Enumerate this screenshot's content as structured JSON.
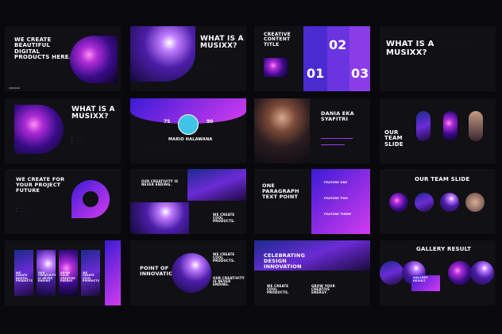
{
  "slides": {
    "s1": {
      "title": "WE CREATE BEAUTIFUL DIGITAL PRODUCTS HERE."
    },
    "s2": {
      "title": "WHAT IS A MUSIXX?"
    },
    "s3": {
      "title": "CREATIVE CONTENT TITLE",
      "n1": "01",
      "n2": "02",
      "n3": "03"
    },
    "s4": {
      "title": "WHAT IS A MUSIXX?"
    },
    "s5": {
      "title": "WHAT IS A MUSIXX?"
    },
    "s6": {
      "name": "MARIO HALAWANA",
      "left": "75",
      "right": "90"
    },
    "s7": {
      "name": "DANIA EKA SYAFITRI"
    },
    "s8": {
      "title": "OUR TEAM SLIDE"
    },
    "s9": {
      "title": "WE CREATE FOR YOUR PROJECT FUTURE"
    },
    "s10": {
      "t1": "OUR CREATIVITY IS NEVER ENDING.",
      "t2": "WE CREATE COOL PRODUCTS."
    },
    "s11": {
      "title": "ONE PARAGRAPH TEXT POINT",
      "f1": "FEATURE ONE",
      "f2": "FEATURE TWO",
      "f3": "FEATURE THREE"
    },
    "s12": {
      "title": "OUR TEAM SLIDE"
    },
    "s13": {
      "c1": "WE CREATE DIGITAL PRODUCTS",
      "c2": "OUR CREATIVITY IS NEVER ENDING",
      "c3": "GROW YOUR CREATIVE ENERGY",
      "c4": "WE CREATE COOL PRODUCTS"
    },
    "s14": {
      "title": "POINT OF INNOVATION",
      "t1": "WE CREATE COOL PRODUCTS.",
      "t2": "OUR CREATIVITY IS NEVER ENDING."
    },
    "s15": {
      "title": "CELEBRATING DESIGN INNOVATION",
      "t1": "WE CREATE COOL PRODUCTS.",
      "t2": "GROW YOUR CREATIVE ENERGY."
    },
    "s16": {
      "title": "GALLERY RESULT",
      "label": "GALLERY RESULT"
    }
  }
}
